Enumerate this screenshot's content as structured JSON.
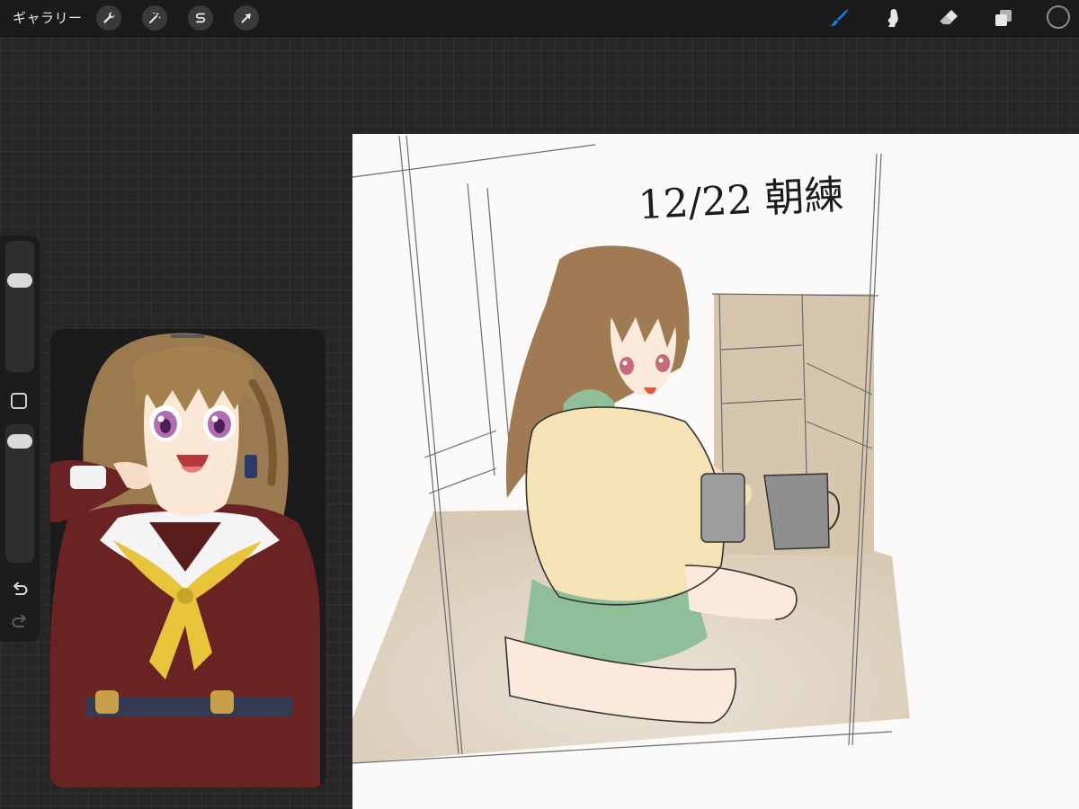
{
  "toolbar": {
    "gallery_label": "ギャラリー",
    "left_tools": [
      {
        "name": "actions",
        "icon": "wrench-icon"
      },
      {
        "name": "adjustments",
        "icon": "magic-wand-icon"
      },
      {
        "name": "selection",
        "icon": "selection-s-icon"
      },
      {
        "name": "transform",
        "icon": "arrow-cursor-icon"
      }
    ],
    "right_tools": [
      {
        "name": "brush",
        "icon": "brush-icon",
        "active": true
      },
      {
        "name": "smudge",
        "icon": "smudge-finger-icon",
        "active": false
      },
      {
        "name": "eraser",
        "icon": "eraser-icon",
        "active": false
      },
      {
        "name": "layers",
        "icon": "layers-icon",
        "active": false
      }
    ],
    "current_color": "#1e1e1e",
    "active_color": "#1e7cf2"
  },
  "sidebar": {
    "brush_size_level": 0.72,
    "opacity_level": 0.92,
    "undo_icon": "undo-icon",
    "redo_icon": "redo-icon"
  },
  "canvas": {
    "handwritten_note": "12/22 朝練"
  }
}
